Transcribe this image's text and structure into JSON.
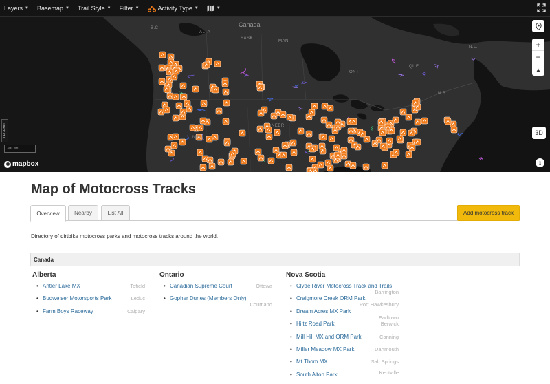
{
  "toolbar": {
    "items": [
      {
        "label": "Layers"
      },
      {
        "label": "Basemap"
      },
      {
        "label": "Trail Style"
      },
      {
        "label": "Filter"
      },
      {
        "label": "Activity Type"
      }
    ]
  },
  "map": {
    "labels": {
      "canada": "Canada",
      "bc": "B.C.",
      "alta": "ALTA",
      "sask": "SASK.",
      "man": "MAN",
      "ont": "ONT",
      "que": "QUE",
      "nl": "N.L.",
      "nb": "N.B.",
      "nebr": "NEBR",
      "nev": "NEV"
    },
    "scale": "300 km",
    "legend": "LEGEND",
    "attribution": "mapbox",
    "controls": {
      "zoom_in": "+",
      "zoom_out": "−",
      "compass": "▲",
      "threed": "3D",
      "info": "i"
    },
    "colors": {
      "background": "#2d2d2d",
      "land": "#2e2e2e",
      "water": "#111111",
      "marker": "#f07b1a"
    }
  },
  "page": {
    "title": "Map of Motocross Tracks",
    "tabs": [
      {
        "label": "Overview",
        "active": true
      },
      {
        "label": "Nearby"
      },
      {
        "label": "List All"
      }
    ],
    "add_button": "Add motocross track",
    "intro": "Directory of dirtbike motocross parks and motocross tracks around the world.",
    "country": "Canada",
    "provinces": [
      {
        "name": "Alberta",
        "tracks": [
          {
            "name": "Antler Lake MX",
            "city": "Tofield"
          },
          {
            "name": "Budweiser Motorsports Park",
            "city": "Leduc"
          },
          {
            "name": "Farm Boys Raceway",
            "city": "Calgary"
          }
        ]
      },
      {
        "name": "Ontario",
        "tracks": [
          {
            "name": "Canadian Supreme Court",
            "city": "Ottawa"
          },
          {
            "name": "Gopher Dunes (Members Only)",
            "city": "Courtland"
          }
        ]
      },
      {
        "name": "Nova Scotia",
        "tracks": [
          {
            "name": "Clyde River Motocross Track and Trails",
            "city": "Barrington"
          },
          {
            "name": "Craigmore Creek ORM Park",
            "city": "Port Hawkesbury"
          },
          {
            "name": "Dream Acres MX Park",
            "city": "Earltown"
          },
          {
            "name": "Hiltz Road Park",
            "city": "Berwick"
          },
          {
            "name": "Mill Hill MX and ORM Park",
            "city": "Canning"
          },
          {
            "name": "Miller Meadow MX Park",
            "city": "Dartmouth"
          },
          {
            "name": "Mt Thom MX",
            "city": "Salt Springs"
          },
          {
            "name": "South Alton Park",
            "city": "Kentville"
          }
        ]
      }
    ]
  }
}
